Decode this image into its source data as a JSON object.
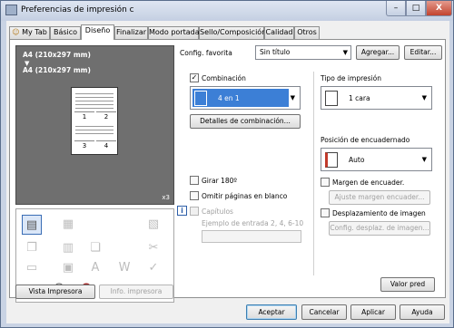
{
  "window": {
    "title": "Preferencias de impresión c",
    "close_glyph": "X"
  },
  "tabs": [
    "My Tab",
    "Básico",
    "Diseño",
    "Finalizar",
    "Modo portada",
    "Sello/Composición",
    "Calidad",
    "Otros"
  ],
  "preview": {
    "paper_top": "A4 (210x297 mm)",
    "arrow": "▼",
    "paper_bottom": "A4 (210x297 mm)",
    "pages": [
      "1",
      "2",
      "3",
      "4"
    ],
    "copies": "x3"
  },
  "favorites": {
    "label": "Config. favorita",
    "value": "Sin título",
    "add_label": "Agregar...",
    "edit_label": "Editar..."
  },
  "combination": {
    "label": "Combinación",
    "checked": true,
    "value": "4 en 1",
    "details_label": "Detalles de combinación..."
  },
  "print_type": {
    "label": "Tipo de impresión",
    "value": "1 cara"
  },
  "binding": {
    "label": "Posición de encuadernado",
    "value": "Auto"
  },
  "options": {
    "rotate_label": "Girar 180º",
    "skip_blank_label": "Omitir páginas en blanco",
    "chapters_label": "Capítulos",
    "chapters_example": "Ejemplo de entrada 2, 4, 6-10",
    "margin_label": "Margen de encuader.",
    "margin_adjust_label": "Ajuste margen encuader...",
    "image_shift_label": "Desplazamiento de imagen",
    "image_shift_config_label": "Config. desplaz. de imagen..."
  },
  "panel_buttons": {
    "printer_view": "Vista Impresora",
    "printer_info": "Info. impresora",
    "default": "Valor pred"
  },
  "dialog_buttons": {
    "ok": "Aceptar",
    "cancel": "Cancelar",
    "apply": "Aplicar",
    "help": "Ayuda"
  }
}
